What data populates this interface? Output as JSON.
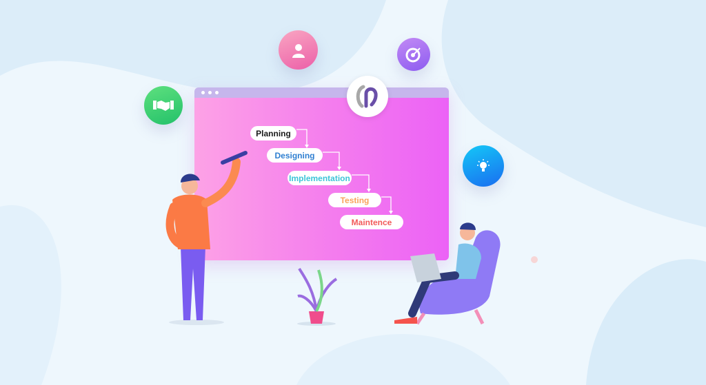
{
  "steps": [
    {
      "label": "Planning",
      "color": "#1a1a1a"
    },
    {
      "label": "Designing",
      "color": "#2f7fd1"
    },
    {
      "label": "Implementation",
      "color": "#3ec4d8"
    },
    {
      "label": "Testing",
      "color": "#f9a35c"
    },
    {
      "label": "Maintence",
      "color": "#f25a5a"
    }
  ],
  "icons": [
    "handshake-icon",
    "user-icon",
    "target-icon",
    "lightbulb-icon",
    "logo-icon"
  ],
  "colors": {
    "window_title_bar": "#c6b6ec",
    "window_gradient_start": "#fda2e6",
    "window_gradient_end": "#ec62f6",
    "background": "#eef7fd"
  }
}
